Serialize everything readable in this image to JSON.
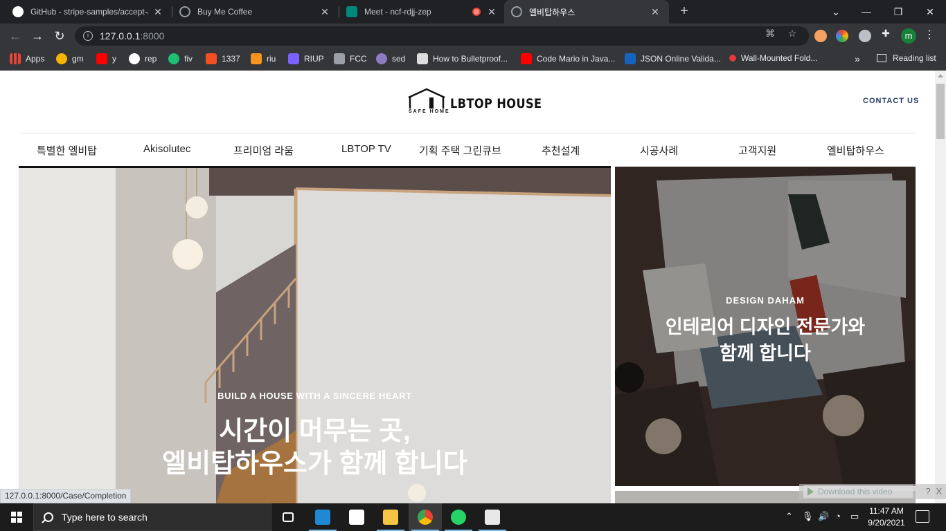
{
  "browser": {
    "tabs": [
      {
        "title": "GitHub - stripe-samples/accept-a",
        "icon": "github-icon",
        "color": "#ffffff"
      },
      {
        "title": "Buy Me Coffee",
        "icon": "globe-icon",
        "color": "#9aa0a6"
      },
      {
        "title": "Meet - ncf-rdjj-zep",
        "icon": "google-meet-icon",
        "color": "#00897b"
      },
      {
        "title": "엘비탑하우스",
        "icon": "globe-icon",
        "color": "#9aa0a6",
        "active": true
      }
    ],
    "new_tab": "+",
    "url_host": "127.0.0.1",
    "url_port": ":8000",
    "profile_initial": "m",
    "bookmarks": [
      {
        "label": "Apps",
        "color": "#ea4335"
      },
      {
        "label": "gm",
        "color": "#f4b400"
      },
      {
        "label": "y",
        "color": "#ff0000"
      },
      {
        "label": "rep",
        "color": "#ffffff"
      },
      {
        "label": "fiv",
        "color": "#1dbf73"
      },
      {
        "label": "1337",
        "color": "#f25022"
      },
      {
        "label": "riu",
        "color": "#f7931e"
      },
      {
        "label": "RIUP",
        "color": "#7b61ff"
      },
      {
        "label": "FCC",
        "color": "#9aa0a6"
      },
      {
        "label": "sed",
        "color": "#8e7cc3"
      },
      {
        "label": "How to Bulletproof...",
        "color": "#dddddd"
      },
      {
        "label": "Code Mario in Java...",
        "color": "#ff0000"
      },
      {
        "label": "JSON Online Valida...",
        "color": "#1565c0"
      },
      {
        "label": "Wall-Mounted Fold...",
        "color": "#e53935"
      }
    ],
    "bookmarks_more": "»",
    "reading_list": "Reading list",
    "status_url": "127.0.0.1:8000/Case/Completion"
  },
  "site": {
    "logo_text": "LBTOP HOUSE",
    "logo_sub": "SAFE HOME",
    "contact": "CONTACT US",
    "nav": [
      "특별한 엘비탑",
      "Akisolutec",
      "프리미엄 라움",
      "LBTOP TV",
      "기획 주택 그린큐브",
      "추천설계",
      "시공사례",
      "고객지원",
      "엘비탑하우스"
    ],
    "hero": {
      "subtitle": "BUILD A HOUSE WITH A SINCERE HEART",
      "title": "시간이 머무는 곳,\n엘비탑하우스가 함께 합니다"
    },
    "side": {
      "subtitle": "DESIGN DAHAM",
      "title": "인테리어 디자인 전문가와\n함께 합니다"
    }
  },
  "download_bar": {
    "label": "Download this video",
    "help": "?",
    "close": "X"
  },
  "taskbar": {
    "search_placeholder": "Type here to search",
    "time": "11:47 AM",
    "date": "9/20/2021"
  }
}
